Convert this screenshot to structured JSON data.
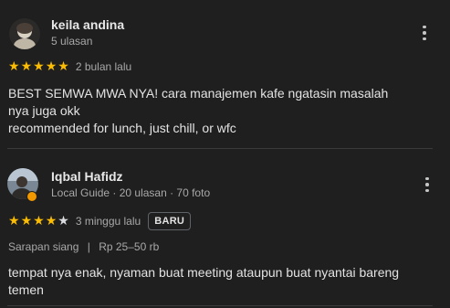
{
  "reviews": [
    {
      "name": "keila andina",
      "meta": "5 ulasan",
      "rating": 5,
      "when": "2 bulan lalu",
      "text_lines": [
        "BEST SEMWA MWA NYA! cara manajemen kafe ngatasin masalah",
        "nya juga okk",
        "recommended for lunch, just chill, or wfc"
      ]
    },
    {
      "name": "Iqbal Hafidz",
      "meta": "Local Guide · 20 ulasan · 70 foto",
      "rating": 4,
      "when": "3 minggu lalu",
      "badge": "BARU",
      "attributes": {
        "meal": "Sarapan siang",
        "separator": "|",
        "price": "Rp 25–50 rb"
      },
      "text_lines": [
        "tempat nya enak, nyaman buat meeting ataupun buat nyantai bareng",
        "temen"
      ]
    }
  ],
  "icons": {
    "star": "star-icon",
    "more": "more-vert-icon"
  },
  "colors": {
    "background": "#1f1f1f",
    "star_filled": "#fbbc04",
    "star_empty": "#dadce0",
    "local_guide_badge": "#f29900"
  }
}
